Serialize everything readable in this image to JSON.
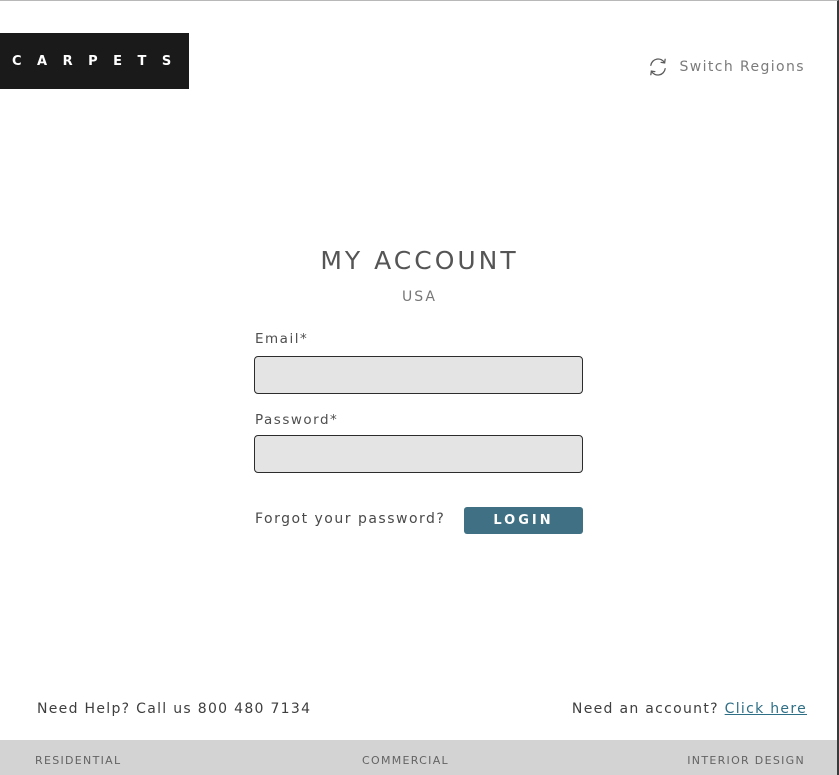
{
  "header": {
    "logo_text": "CARPETS",
    "switch_regions_label": "Switch Regions",
    "switch_icon": "refresh-icon"
  },
  "main": {
    "title": "MY ACCOUNT",
    "region": "USA",
    "email_label": "Email*",
    "email_value": "",
    "password_label": "Password*",
    "password_value": "",
    "forgot_label": "Forgot your password?",
    "login_label": "LOGIN"
  },
  "bottom": {
    "help_text": "Need Help? Call us 800 480 7134",
    "account_prompt": "Need an account?",
    "account_link": "Click here"
  },
  "footer": {
    "items": [
      "RESIDENTIAL",
      "COMMERCIAL",
      "INTERIOR DESIGN"
    ]
  },
  "colors": {
    "accent": "#3f7084",
    "link": "#2f6f86",
    "logo_bg": "#1b1a1a",
    "field_bg": "#e4e4e4",
    "footer_bg": "#d3d3d3"
  }
}
